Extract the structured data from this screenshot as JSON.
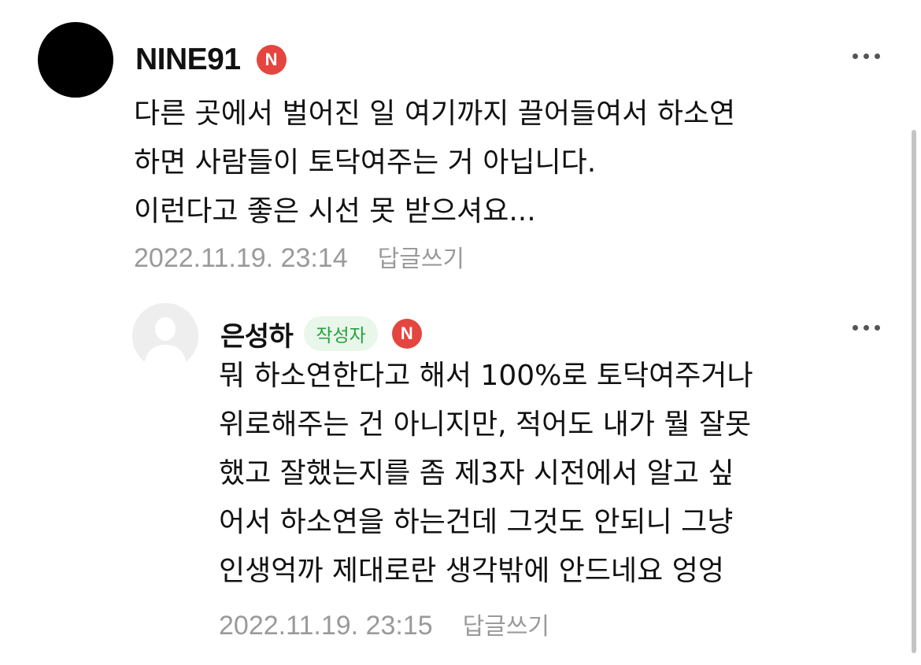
{
  "comments": [
    {
      "nickname": "NINE91",
      "badge": "N",
      "text_lines": [
        "다른 곳에서 벌어진 일 여기까지 끌어들여서 하소연",
        "하면 사람들이 토닥여주는 거 아닙니다.",
        "이런다고 좋은 시선 못 받으셔요..."
      ],
      "date": "2022.11.19. 23:14",
      "reply_label": "답글쓰기"
    },
    {
      "nickname": "은성하",
      "writer_badge": "작성자",
      "badge": "N",
      "text_lines": [
        "뭐 하소연한다고 해서 100%로 토닥여주거나",
        "위로해주는 건 아니지만, 적어도 내가 뭘 잘못",
        "했고 잘했는지를 좀 제3자 시전에서 알고 싶",
        "어서 하소연을 하는건데 그것도 안되니 그냥",
        "인생억까 제대로란 생각밖에 안드네요 엉엉"
      ],
      "date": "2022.11.19. 23:15",
      "reply_label": "답글쓰기"
    }
  ],
  "colors": {
    "n_badge": "#e4463f",
    "writer_badge_bg": "#e9f6ea",
    "writer_badge_text": "#25a23f",
    "meta_text": "#9a9a9a"
  },
  "icons": {
    "more": "more-dots-icon",
    "default_avatar": "default-profile-icon"
  }
}
